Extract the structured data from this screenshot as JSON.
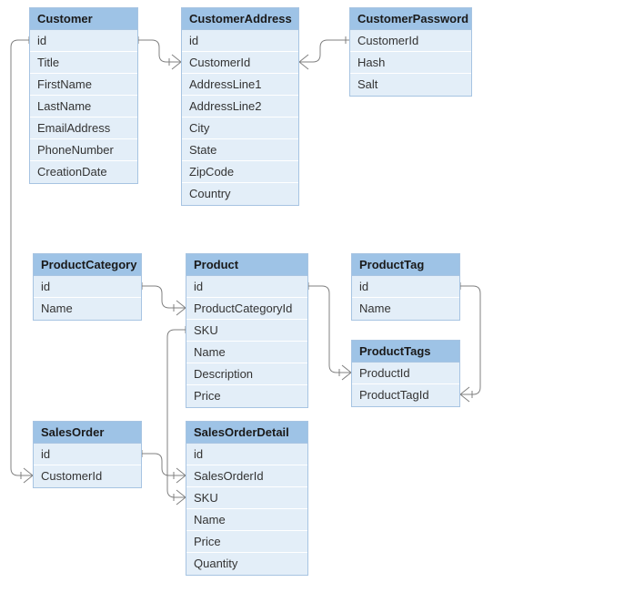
{
  "entities": {
    "customer": {
      "title": "Customer",
      "fields": [
        "id",
        "Title",
        "FirstName",
        "LastName",
        "EmailAddress",
        "PhoneNumber",
        "CreationDate"
      ]
    },
    "customerAddress": {
      "title": "CustomerAddress",
      "fields": [
        "id",
        "CustomerId",
        "AddressLine1",
        "AddressLine2",
        "City",
        "State",
        "ZipCode",
        "Country"
      ]
    },
    "customerPassword": {
      "title": "CustomerPassword",
      "fields": [
        "CustomerId",
        "Hash",
        "Salt"
      ]
    },
    "productCategory": {
      "title": "ProductCategory",
      "fields": [
        "id",
        "Name"
      ]
    },
    "product": {
      "title": "Product",
      "fields": [
        "id",
        "ProductCategoryId",
        "SKU",
        "Name",
        "Description",
        "Price"
      ]
    },
    "productTag": {
      "title": "ProductTag",
      "fields": [
        "id",
        "Name"
      ]
    },
    "productTags": {
      "title": "ProductTags",
      "fields": [
        "ProductId",
        "ProductTagId"
      ]
    },
    "salesOrder": {
      "title": "SalesOrder",
      "fields": [
        "id",
        "CustomerId"
      ]
    },
    "salesOrderDetail": {
      "title": "SalesOrderDetail",
      "fields": [
        "id",
        "SalesOrderId",
        "SKU",
        "Name",
        "Price",
        "Quantity"
      ]
    }
  },
  "relationships": [
    {
      "from": "Customer.id",
      "to": "CustomerAddress.CustomerId",
      "type": "one-to-many"
    },
    {
      "from": "Customer.id",
      "to": "CustomerPassword.CustomerId",
      "type": "one-to-one"
    },
    {
      "from": "ProductCategory.id",
      "to": "Product.ProductCategoryId",
      "type": "one-to-many"
    },
    {
      "from": "Product.id",
      "to": "ProductTags.ProductId",
      "type": "one-to-many"
    },
    {
      "from": "ProductTag.id",
      "to": "ProductTags.ProductTagId",
      "type": "one-to-many"
    },
    {
      "from": "SalesOrder.id",
      "to": "SalesOrderDetail.SalesOrderId",
      "type": "one-to-many"
    },
    {
      "from": "Customer.id",
      "to": "SalesOrder.CustomerId",
      "type": "one-to-many"
    },
    {
      "from": "Product.SKU",
      "to": "SalesOrderDetail.SKU",
      "type": "one-to-many"
    }
  ],
  "colors": {
    "entityHeader": "#9ec3e6",
    "entityRow": "#e3eef8",
    "entityBorder": "#a7c4e2",
    "connector": "#808080"
  }
}
